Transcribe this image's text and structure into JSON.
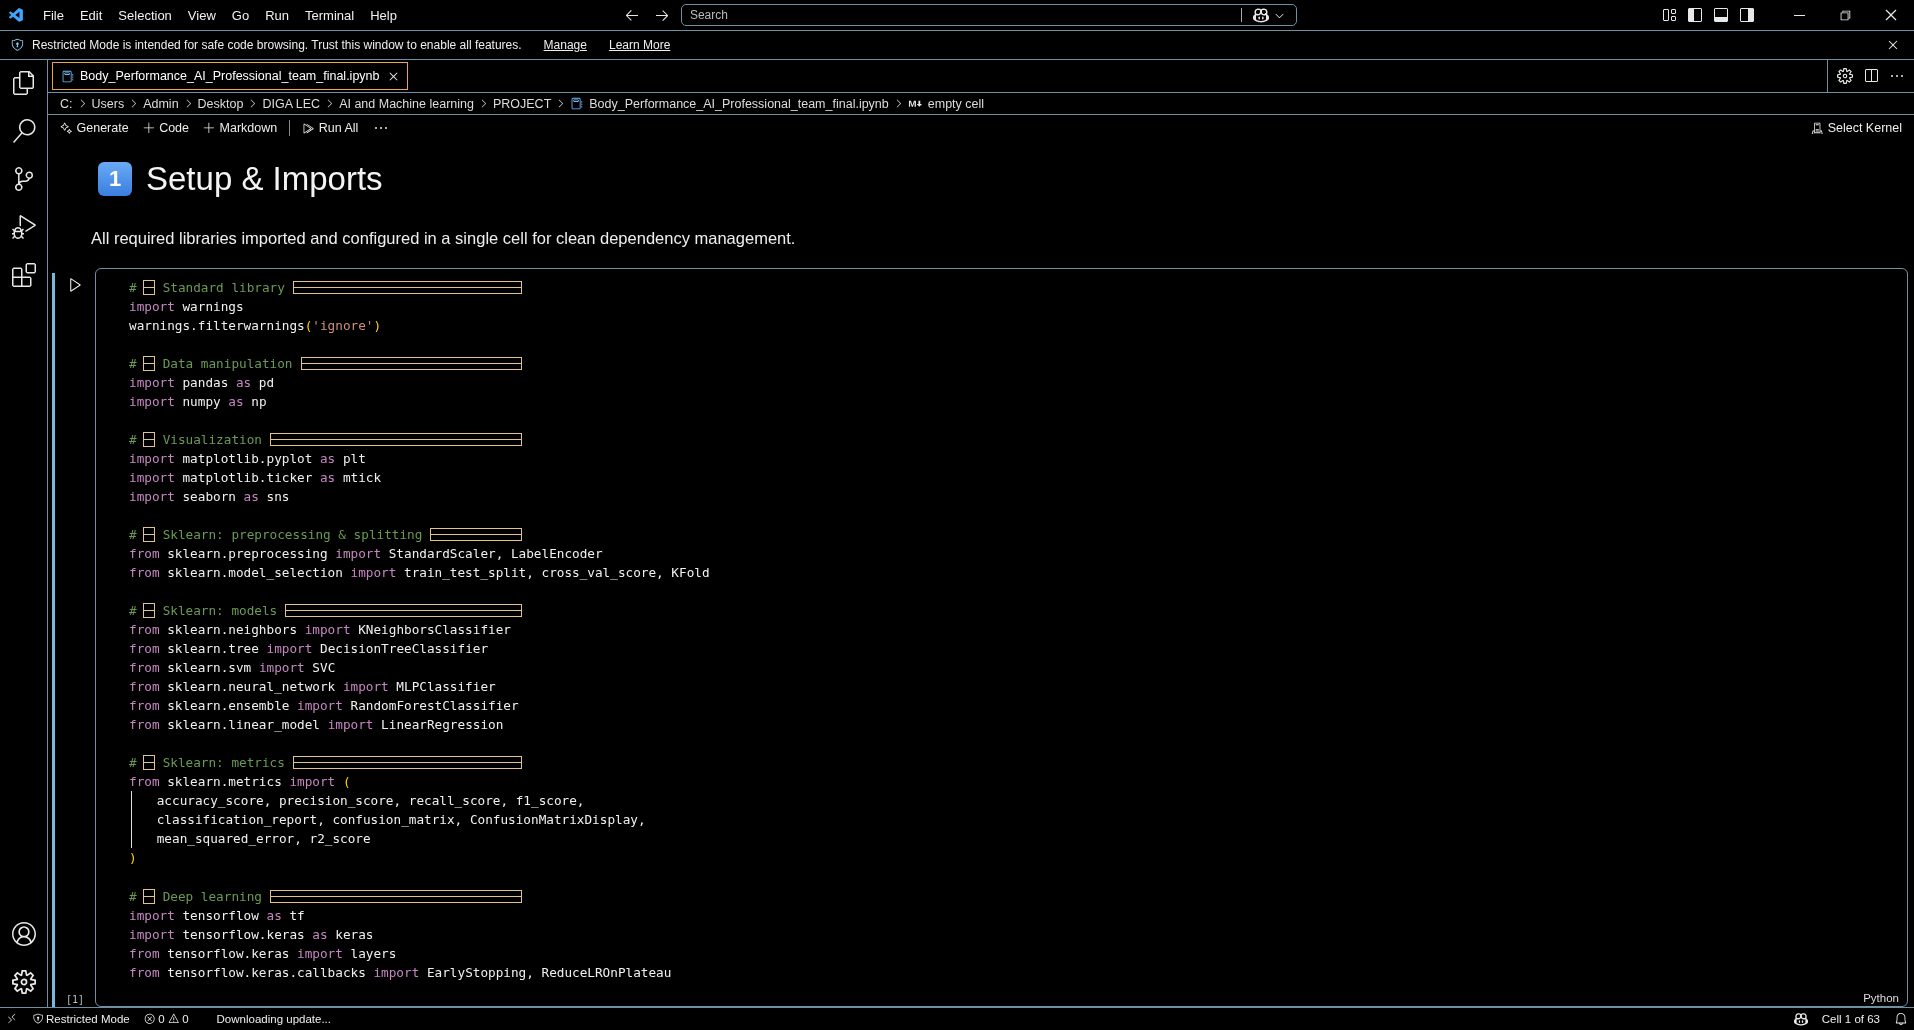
{
  "menu_bar": {
    "items": [
      "File",
      "Edit",
      "Selection",
      "View",
      "Go",
      "Run",
      "Terminal",
      "Help"
    ]
  },
  "search": {
    "placeholder": "Search"
  },
  "banner": {
    "text": "Restricted Mode is intended for safe code browsing. Trust this window to enable all features.",
    "links": [
      "Manage",
      "Learn More"
    ]
  },
  "editor_tabs": [
    {
      "title": "Body_Performance_AI_Professional_team_final.ipynb",
      "selected": true
    }
  ],
  "breadcrumb": [
    {
      "text": "C:",
      "kind": "plain"
    },
    {
      "text": "Users",
      "kind": "plain"
    },
    {
      "text": "Admin",
      "kind": "plain"
    },
    {
      "text": "Desktop",
      "kind": "plain"
    },
    {
      "text": "DIGA LEC",
      "kind": "plain"
    },
    {
      "text": "AI and Machine learning",
      "kind": "plain"
    },
    {
      "text": "PROJECT",
      "kind": "plain"
    },
    {
      "text": "Body_Performance_AI_Professional_team_final.ipynb",
      "kind": "notebook"
    },
    {
      "text": "empty cell",
      "kind": "markdown"
    }
  ],
  "notebook_toolbar": {
    "actions": [
      {
        "label": "Generate",
        "kind": "generate"
      },
      {
        "label": "Code",
        "kind": "add"
      },
      {
        "label": "Markdown",
        "kind": "add"
      },
      {
        "label": "Run All",
        "kind": "run"
      }
    ],
    "kernel": "Select Kernel"
  },
  "heading": {
    "number": "1",
    "title": "Setup & Imports"
  },
  "description": "All required libraries imported and configured in a single cell for clean dependency management.",
  "cell": {
    "execution_count": "[1]",
    "language": "Python",
    "lines": [
      {
        "kind": "section",
        "hash": "#",
        "text": "Standard library"
      },
      {
        "kind": "code",
        "tokens": [
          {
            "kind": "kw",
            "text": "import"
          },
          {
            "kind": "id",
            "text": " warnings"
          }
        ]
      },
      {
        "kind": "code",
        "tokens": [
          {
            "kind": "id",
            "text": "warnings.filterwarnings"
          },
          {
            "kind": "bracket",
            "text": "("
          },
          {
            "kind": "str",
            "text": "'ignore'"
          },
          {
            "kind": "bracket",
            "text": ")"
          }
        ]
      },
      {
        "kind": "blank"
      },
      {
        "kind": "section",
        "hash": "#",
        "text": "Data manipulation"
      },
      {
        "kind": "code",
        "tokens": [
          {
            "kind": "kw",
            "text": "import"
          },
          {
            "kind": "id",
            "text": " pandas "
          },
          {
            "kind": "kw",
            "text": "as"
          },
          {
            "kind": "id",
            "text": " pd"
          }
        ]
      },
      {
        "kind": "code",
        "tokens": [
          {
            "kind": "kw",
            "text": "import"
          },
          {
            "kind": "id",
            "text": " numpy "
          },
          {
            "kind": "kw",
            "text": "as"
          },
          {
            "kind": "id",
            "text": " np"
          }
        ]
      },
      {
        "kind": "blank"
      },
      {
        "kind": "section",
        "hash": "#",
        "text": "Visualization"
      },
      {
        "kind": "code",
        "tokens": [
          {
            "kind": "kw",
            "text": "import"
          },
          {
            "kind": "id",
            "text": " matplotlib.pyplot "
          },
          {
            "kind": "kw",
            "text": "as"
          },
          {
            "kind": "id",
            "text": " plt"
          }
        ]
      },
      {
        "kind": "code",
        "tokens": [
          {
            "kind": "kw",
            "text": "import"
          },
          {
            "kind": "id",
            "text": " matplotlib.ticker "
          },
          {
            "kind": "kw",
            "text": "as"
          },
          {
            "kind": "id",
            "text": " mtick"
          }
        ]
      },
      {
        "kind": "code",
        "tokens": [
          {
            "kind": "kw",
            "text": "import"
          },
          {
            "kind": "id",
            "text": " seaborn "
          },
          {
            "kind": "kw",
            "text": "as"
          },
          {
            "kind": "id",
            "text": " sns"
          }
        ]
      },
      {
        "kind": "blank"
      },
      {
        "kind": "section",
        "hash": "#",
        "text": "Sklearn: preprocessing & splitting"
      },
      {
        "kind": "code",
        "tokens": [
          {
            "kind": "kw",
            "text": "from"
          },
          {
            "kind": "id",
            "text": " sklearn.preprocessing "
          },
          {
            "kind": "kw",
            "text": "import"
          },
          {
            "kind": "id",
            "text": " StandardScaler, LabelEncoder"
          }
        ]
      },
      {
        "kind": "code",
        "tokens": [
          {
            "kind": "kw",
            "text": "from"
          },
          {
            "kind": "id",
            "text": " sklearn.model_selection "
          },
          {
            "kind": "kw",
            "text": "import"
          },
          {
            "kind": "id",
            "text": " train_test_split, cross_val_score, KFold"
          }
        ]
      },
      {
        "kind": "blank"
      },
      {
        "kind": "section",
        "hash": "#",
        "text": "Sklearn: models"
      },
      {
        "kind": "code",
        "tokens": [
          {
            "kind": "kw",
            "text": "from"
          },
          {
            "kind": "id",
            "text": " sklearn.neighbors "
          },
          {
            "kind": "kw",
            "text": "import"
          },
          {
            "kind": "id",
            "text": " KNeighborsClassifier"
          }
        ]
      },
      {
        "kind": "code",
        "tokens": [
          {
            "kind": "kw",
            "text": "from"
          },
          {
            "kind": "id",
            "text": " sklearn.tree "
          },
          {
            "kind": "kw",
            "text": "import"
          },
          {
            "kind": "id",
            "text": " DecisionTreeClassifier"
          }
        ]
      },
      {
        "kind": "code",
        "tokens": [
          {
            "kind": "kw",
            "text": "from"
          },
          {
            "kind": "id",
            "text": " sklearn.svm "
          },
          {
            "kind": "kw",
            "text": "import"
          },
          {
            "kind": "id",
            "text": " SVC"
          }
        ]
      },
      {
        "kind": "code",
        "tokens": [
          {
            "kind": "kw",
            "text": "from"
          },
          {
            "kind": "id",
            "text": " sklearn.neural_network "
          },
          {
            "kind": "kw",
            "text": "import"
          },
          {
            "kind": "id",
            "text": " MLPClassifier"
          }
        ]
      },
      {
        "kind": "code",
        "tokens": [
          {
            "kind": "kw",
            "text": "from"
          },
          {
            "kind": "id",
            "text": " sklearn.ensemble "
          },
          {
            "kind": "kw",
            "text": "import"
          },
          {
            "kind": "id",
            "text": " RandomForestClassifier"
          }
        ]
      },
      {
        "kind": "code",
        "tokens": [
          {
            "kind": "kw",
            "text": "from"
          },
          {
            "kind": "id",
            "text": " sklearn.linear_model "
          },
          {
            "kind": "kw",
            "text": "import"
          },
          {
            "kind": "id",
            "text": " LinearRegression"
          }
        ]
      },
      {
        "kind": "blank"
      },
      {
        "kind": "section",
        "hash": "#",
        "text": "Sklearn: metrics"
      },
      {
        "kind": "code",
        "tokens": [
          {
            "kind": "kw",
            "text": "from"
          },
          {
            "kind": "id",
            "text": " sklearn.metrics "
          },
          {
            "kind": "kw",
            "text": "import"
          },
          {
            "kind": "bracket",
            "text": " ("
          }
        ]
      },
      {
        "kind": "continuation",
        "tokens": [
          {
            "kind": "id",
            "text": "accuracy_score, precision_score, recall_score, f1_score,"
          }
        ]
      },
      {
        "kind": "continuation",
        "tokens": [
          {
            "kind": "id",
            "text": "classification_report, confusion_matrix, ConfusionMatrixDisplay,"
          }
        ]
      },
      {
        "kind": "continuation",
        "tokens": [
          {
            "kind": "id",
            "text": "mean_squared_error, r2_score"
          }
        ]
      },
      {
        "kind": "code",
        "tokens": [
          {
            "kind": "bracket",
            "text": ")"
          }
        ]
      },
      {
        "kind": "blank"
      },
      {
        "kind": "section",
        "hash": "#",
        "text": "Deep learning"
      },
      {
        "kind": "code",
        "tokens": [
          {
            "kind": "kw",
            "text": "import"
          },
          {
            "kind": "id",
            "text": " tensorflow "
          },
          {
            "kind": "kw",
            "text": "as"
          },
          {
            "kind": "id",
            "text": " tf"
          }
        ]
      },
      {
        "kind": "code",
        "tokens": [
          {
            "kind": "kw",
            "text": "import"
          },
          {
            "kind": "id",
            "text": " tensorflow.keras "
          },
          {
            "kind": "kw",
            "text": "as"
          },
          {
            "kind": "id",
            "text": " keras"
          }
        ]
      },
      {
        "kind": "code",
        "tokens": [
          {
            "kind": "kw",
            "text": "from"
          },
          {
            "kind": "id",
            "text": " tensorflow.keras "
          },
          {
            "kind": "kw",
            "text": "import"
          },
          {
            "kind": "id",
            "text": " layers"
          }
        ]
      },
      {
        "kind": "code",
        "tokens": [
          {
            "kind": "kw",
            "text": "from"
          },
          {
            "kind": "id",
            "text": " tensorflow.keras.callbacks "
          },
          {
            "kind": "kw",
            "text": "import"
          },
          {
            "kind": "id",
            "text": " EarlyStopping, ReduceLROnPlateau"
          }
        ]
      }
    ]
  },
  "status_bar": {
    "mode": "Restricted Mode",
    "errors": "0",
    "warnings": "0",
    "message": "Downloading update...",
    "cell_position": "Cell 1 of 63"
  }
}
